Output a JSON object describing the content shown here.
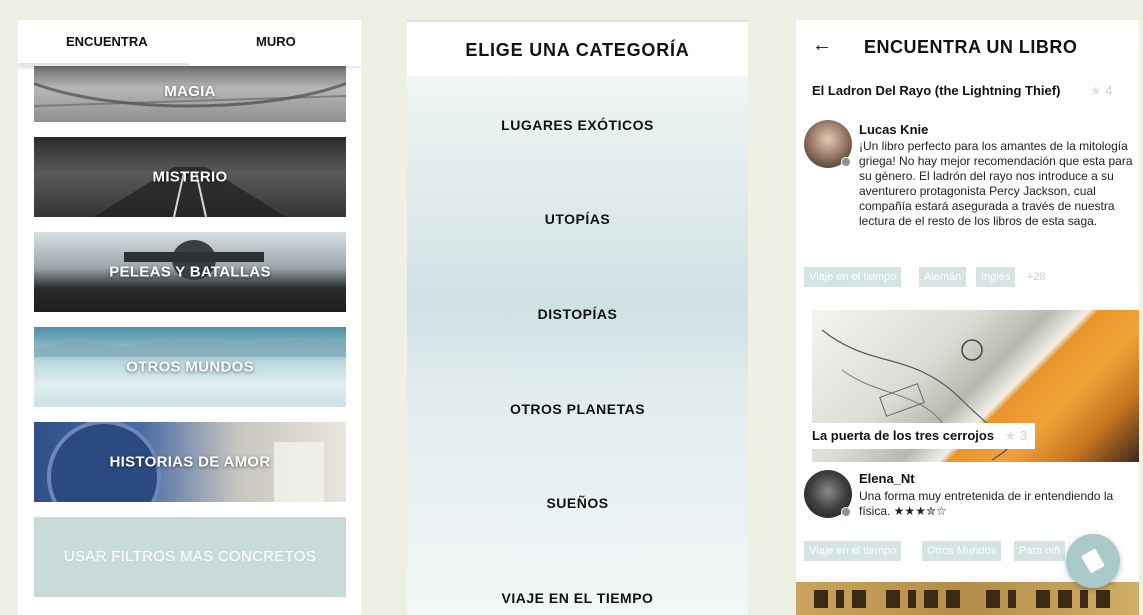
{
  "panel1": {
    "tabs": [
      "ENCUENTRA",
      "MURO"
    ],
    "categories": [
      "MAGIA",
      "MISTERIO",
      "PELEAS Y BATALLAS",
      "OTROS MUNDOS",
      "HISTORIAS DE AMOR"
    ],
    "filter_button": "USAR FILTROS MAS CONCRETOS"
  },
  "panel2": {
    "title": "ELIGE UNA CATEGORÍA",
    "items": [
      "LUGARES EXÓTICOS",
      "UTOPÍAS",
      "DISTOPÍAS",
      "OTROS PLANETAS",
      "SUEÑOS",
      "VIAJE EN EL TIEMPO"
    ]
  },
  "panel3": {
    "back_icon": "←",
    "title": "ENCUENTRA UN LIBRO",
    "books": [
      {
        "title": "El Ladron Del Rayo (the Lightning Thief)",
        "rating": "4",
        "user": "Lucas Knie",
        "review": "¡Un libro perfecto para los amantes de la mitología griega! No hay mejor recomendación que esta para su género. El ladrón del rayo nos introduce a su aventurero protagonista Percy Jackson, cual compañía estará asegurada a través de nuestra lectura de el resto de los libros de esta saga.",
        "tags": [
          "Viaje en el tiempo",
          "Alemán",
          "Inglés"
        ],
        "more": "+28"
      },
      {
        "title": "La puerta de los tres cerrojos",
        "rating": "3",
        "user": "Elena_Nt",
        "review": "Una forma muy entretenida de ir entendiendo la física. ★★★✮☆",
        "tags": [
          "Viaje en el tiempo",
          "Otros Mundos",
          "Para niñ"
        ]
      }
    ],
    "star_glyph": "★",
    "colors": {
      "tag_bg": "#d4e4e3",
      "filter_bg": "#c9dbd9",
      "fab_bg": "#a9cac9"
    }
  }
}
